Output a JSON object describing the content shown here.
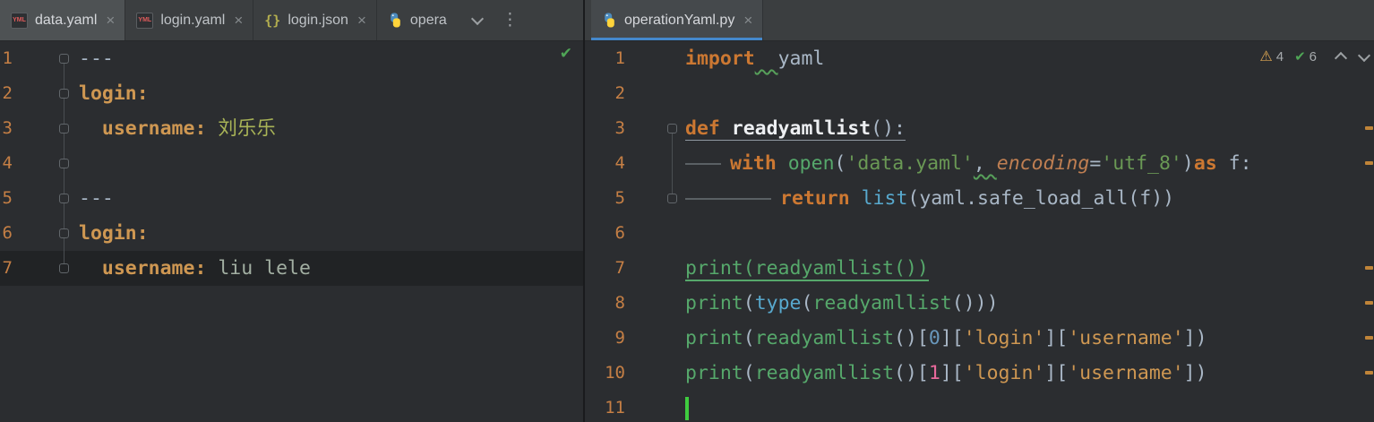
{
  "tabbar": {
    "left_tabs": [
      {
        "label": "data.yaml",
        "type": "yaml",
        "active": true
      },
      {
        "label": "login.yaml",
        "type": "yaml",
        "active": false
      },
      {
        "label": "login.json",
        "type": "json",
        "active": false
      },
      {
        "label": "opera",
        "type": "python",
        "active": false,
        "truncated": true
      }
    ],
    "right_tab": {
      "label": "operationYaml.py",
      "type": "python",
      "active": true
    }
  },
  "icons": {
    "close": "×",
    "kebab": "⋮",
    "warning": "⚠",
    "check": "✔",
    "yaml_badge": "YML",
    "json_badge": "{}"
  },
  "colors": {
    "active_tab_underline": "#4488CC",
    "scrollbar_warning_mark": "#C08438",
    "inspection_ok_green": "#4FA556",
    "inspection_warning_yellow": "#DBA552",
    "caret_green": "#3FCB3F",
    "line_number_orange": "#C57F45"
  },
  "left_editor": {
    "language": "yaml",
    "lines": [
      {
        "num": "1",
        "fold": true,
        "tokens": [
          {
            "t": "---",
            "c": "txt"
          }
        ]
      },
      {
        "num": "2",
        "fold": true,
        "tokens": [
          {
            "t": "login:",
            "c": "key"
          }
        ]
      },
      {
        "num": "3",
        "fold": true,
        "tokens": [
          {
            "t": "  ",
            "c": "txt"
          },
          {
            "t": "username:",
            "c": "key"
          },
          {
            "t": " ",
            "c": "txt"
          },
          {
            "t": "刘乐乐",
            "c": "val"
          }
        ]
      },
      {
        "num": "4",
        "fold": true,
        "tokens": []
      },
      {
        "num": "5",
        "fold": true,
        "tokens": [
          {
            "t": "---",
            "c": "txt"
          }
        ]
      },
      {
        "num": "6",
        "fold": true,
        "tokens": [
          {
            "t": "login:",
            "c": "key"
          }
        ]
      },
      {
        "num": "7",
        "fold": true,
        "hl": true,
        "tokens": [
          {
            "t": "  ",
            "c": "txt"
          },
          {
            "t": "username:",
            "c": "key"
          },
          {
            "t": " ",
            "c": "txt"
          },
          {
            "t": "liu lele",
            "c": "val2"
          }
        ]
      }
    ]
  },
  "right_editor": {
    "language": "python",
    "inspections": {
      "warning_count": "4",
      "ok_count": "6"
    },
    "warning_lines": [
      3,
      4,
      7,
      8,
      9,
      10
    ],
    "lines": [
      {
        "num": "1",
        "tokens": [
          {
            "t": "import",
            "c": "kw"
          },
          {
            "t": "  ",
            "c": "txt",
            "u": "wavy"
          },
          {
            "t": "yaml",
            "c": "txt"
          }
        ]
      },
      {
        "num": "2",
        "tokens": []
      },
      {
        "num": "3",
        "fold": true,
        "tokens": [
          {
            "t": "def ",
            "c": "kw",
            "u": "gray"
          },
          {
            "t": "readyamllist",
            "c": "def",
            "u": "gray"
          },
          {
            "t": "():",
            "c": "txt",
            "u": "gray"
          }
        ]
      },
      {
        "num": "4",
        "tokens": [
          {
            "tab": 40
          },
          {
            "t": "with ",
            "c": "kw"
          },
          {
            "t": "open",
            "c": "call"
          },
          {
            "t": "(",
            "c": "txt"
          },
          {
            "t": "'data.yaml'",
            "c": "str"
          },
          {
            "t": ", ",
            "c": "txt",
            "u": "wavy"
          },
          {
            "t": "encoding",
            "c": "kwarg"
          },
          {
            "t": "=",
            "c": "txt"
          },
          {
            "t": "'utf_8'",
            "c": "str"
          },
          {
            "t": ")",
            "c": "txt"
          },
          {
            "t": "as",
            "c": "kw"
          },
          {
            "t": " f:",
            "c": "txt"
          }
        ]
      },
      {
        "num": "5",
        "fold": true,
        "tokens": [
          {
            "tab": 96
          },
          {
            "t": "return ",
            "c": "kw"
          },
          {
            "t": "list",
            "c": "builtin"
          },
          {
            "t": "(yaml.safe_load_all(f))",
            "c": "txt"
          }
        ]
      },
      {
        "num": "6",
        "tokens": []
      },
      {
        "num": "7",
        "tokens": [
          {
            "t": "print(readyamllist())",
            "c": "call",
            "u": "cur"
          }
        ]
      },
      {
        "num": "8",
        "tokens": [
          {
            "t": "print",
            "c": "call"
          },
          {
            "t": "(",
            "c": "txt"
          },
          {
            "t": "type",
            "c": "builtin"
          },
          {
            "t": "(",
            "c": "txt"
          },
          {
            "t": "readyamllist",
            "c": "call"
          },
          {
            "t": "()))",
            "c": "txt"
          }
        ]
      },
      {
        "num": "9",
        "tokens": [
          {
            "t": "print",
            "c": "call"
          },
          {
            "t": "(",
            "c": "txt"
          },
          {
            "t": "readyamllist",
            "c": "call"
          },
          {
            "t": "()[",
            "c": "txt"
          },
          {
            "t": "0",
            "c": "numb"
          },
          {
            "t": "][",
            "c": "txt"
          },
          {
            "t": "'login'",
            "c": "gold"
          },
          {
            "t": "][",
            "c": "txt"
          },
          {
            "t": "'username'",
            "c": "gold"
          },
          {
            "t": "])",
            "c": "txt"
          }
        ]
      },
      {
        "num": "10",
        "tokens": [
          {
            "t": "print",
            "c": "call"
          },
          {
            "t": "(",
            "c": "txt"
          },
          {
            "t": "readyamllist",
            "c": "call"
          },
          {
            "t": "()[",
            "c": "txt"
          },
          {
            "t": "1",
            "c": "nump"
          },
          {
            "t": "][",
            "c": "txt"
          },
          {
            "t": "'login'",
            "c": "gold"
          },
          {
            "t": "][",
            "c": "txt"
          },
          {
            "t": "'username'",
            "c": "gold"
          },
          {
            "t": "])",
            "c": "txt"
          }
        ]
      },
      {
        "num": "11",
        "caret": true,
        "tokens": []
      }
    ]
  }
}
